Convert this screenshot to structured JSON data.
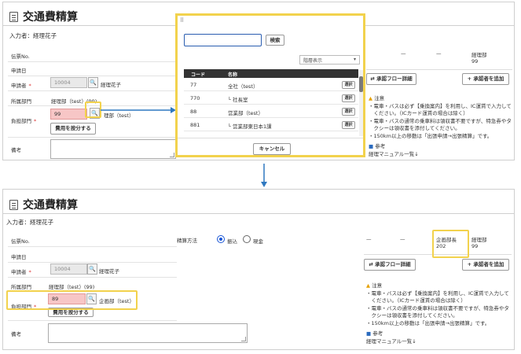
{
  "title": "交通費精算",
  "subtitle": "入力者：経理花子",
  "labels": {
    "voucher_no": "伝票No.",
    "date": "申請日",
    "applicant": "申請者",
    "department": "所属部門",
    "cost_dept": "負担部門",
    "remarks": "備考",
    "payment_method": "精算方法",
    "required_mark": "*"
  },
  "applicant": {
    "code": "10004",
    "name": "経理花子"
  },
  "department_value": "経理部（test）(99)",
  "top": {
    "cost_dept_code": "99",
    "cost_dept_name": "理部（test）",
    "split_button": "費用を按分する",
    "approver_dash1": "—",
    "approver_dash2": "—",
    "approver_dept": "経理部",
    "approver_num": "99",
    "flow_button": "承認フロー詳細",
    "add_approver_button": "+ 承認者を追加"
  },
  "bottom": {
    "cost_dept_code": "89",
    "cost_dept_name": "企画部（test）",
    "split_button": "費用を按分する",
    "payment_options": [
      "振込",
      "現金"
    ],
    "approver_dash1": "—",
    "approver_dash2": "—",
    "approver1_title": "企画部長",
    "approver1_num": "202",
    "approver2_dept": "経理部",
    "approver2_num": "99",
    "flow_button": "承認フロー詳細",
    "add_approver_button": "+ 承認者を追加"
  },
  "notes": {
    "caution_title": "注意",
    "caution_lines": [
      "・電車・バスは必ず【乗換案内】を利用し、IC運賃で入力して",
      "　ください。（ICカード運賃の場合は除く）",
      "・電車・バスの通常の乗車料は領収書不要ですが、特急券やタ",
      "　クシーは領収書を添付してください。",
      "・150km以上の移動は「出張申請→出張精算」です。"
    ],
    "ref_title": "参考",
    "ref_link": "経理マニュアル一覧↓"
  },
  "modal": {
    "handle": "⠿",
    "search_button": "検索",
    "select_value": "階層表示",
    "col_code": "コード",
    "col_name": "名称",
    "rows": [
      {
        "code": "77",
        "name": "全社（test）",
        "btn": "選択"
      },
      {
        "code": "770",
        "name": "└ 社長室",
        "btn": "選択"
      },
      {
        "code": "88",
        "name": "営業部（test）",
        "btn": "選択"
      },
      {
        "code": "881",
        "name": "└ 営業部東日本1課",
        "btn": "選択"
      }
    ],
    "cancel_button": "キャンセル"
  },
  "icons": {
    "search": "🔍",
    "flow": "⇄",
    "warning": "▲",
    "info": "■"
  },
  "colors": {
    "highlight": "#f2d24d",
    "arrow": "#2f78c0",
    "pink_field": "#f7c6c6",
    "radio_accent": "#1a56d6"
  }
}
